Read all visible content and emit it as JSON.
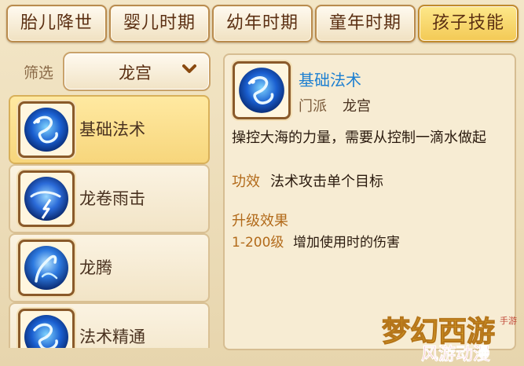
{
  "tabs": [
    {
      "label": "胎儿降世",
      "active": false
    },
    {
      "label": "婴儿时期",
      "active": false
    },
    {
      "label": "幼年时期",
      "active": false
    },
    {
      "label": "童年时期",
      "active": false
    },
    {
      "label": "孩子技能",
      "active": true
    }
  ],
  "filter": {
    "label": "筛选",
    "selected": "龙宫",
    "icon": "chevron-down-icon"
  },
  "skills": [
    {
      "name": "基础法术",
      "icon": "dragon-orb-icon",
      "selected": true
    },
    {
      "name": "龙卷雨击",
      "icon": "storm-orb-icon",
      "selected": false
    },
    {
      "name": "龙腾",
      "icon": "dragon-rise-icon",
      "selected": false
    },
    {
      "name": "法术精通",
      "icon": "dragon-orb-icon",
      "selected": false
    }
  ],
  "detail": {
    "title": "基础法术",
    "school_label": "门派",
    "school_value": "龙宫",
    "description": "操控大海的力量，需要从控制一滴水做起",
    "effect_label": "功效",
    "effect_value": "法术攻击单个目标",
    "upgrade_title": "升级效果",
    "upgrade_range": "1-200级",
    "upgrade_value": "增加使用时的伤害"
  },
  "watermark": {
    "brand": "梦幻西游",
    "sub": "手游",
    "site": "风游动漫"
  },
  "colors": {
    "accent_blue": "#1c7fd1",
    "tab_active": "#f3c955",
    "label_brown": "#b26a1a"
  }
}
